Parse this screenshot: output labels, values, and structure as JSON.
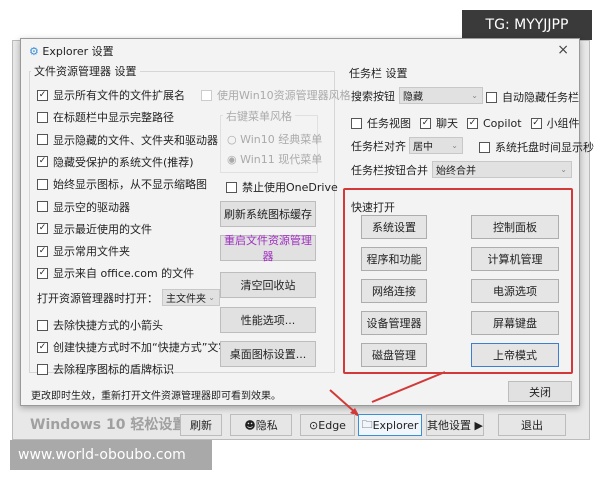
{
  "badge": "TG: MYYJJPP",
  "watermark": "www.world-oboubo.com",
  "dialog": {
    "title": "Explorer 设置",
    "close_icon": "×",
    "explorer_group": {
      "label": "文件资源管理器 设置",
      "options": [
        {
          "label": "显示所有文件的文件扩展名",
          "checked": true
        },
        {
          "label": "在标题栏中显示完整路径",
          "checked": false
        },
        {
          "label": "显示隐藏的文件、文件夹和驱动器",
          "checked": false
        },
        {
          "label": "隐藏受保护的系统文件(推荐)",
          "checked": true
        },
        {
          "label": "始终显示图标，从不显示缩略图",
          "checked": false
        },
        {
          "label": "显示空的驱动器",
          "checked": false
        },
        {
          "label": "显示最近使用的文件",
          "checked": true
        },
        {
          "label": "显示常用文件夹",
          "checked": true
        },
        {
          "label": "显示来自 office.com 的文件",
          "checked": true
        }
      ],
      "open_label": "打开资源管理器时打开：",
      "open_value": "主文件夹",
      "options2": [
        {
          "label": "去除快捷方式的小箭头",
          "checked": false
        },
        {
          "label": "创建快捷方式时不加“快捷方式”文字",
          "checked": true
        },
        {
          "label": "去除程序图标的盾牌标识",
          "checked": false
        }
      ],
      "win10_style": "使用Win10资源管理器风格",
      "menu_style": {
        "label": "右键菜单风格",
        "opt1": "Win10 经典菜单",
        "opt2": "Win11 现代菜单",
        "selected": "Win11 现代菜单"
      },
      "onedrive": "禁止使用OneDrive",
      "buttons": [
        "刷新系统图标缓存",
        "重启文件资源管理器",
        "清空回收站",
        "性能选项...",
        "桌面图标设置..."
      ]
    },
    "taskbar_group": {
      "label": "任务栏 设置",
      "search_label": "搜索按钮",
      "search_value": "隐藏",
      "autohide": "自动隐藏任务栏",
      "task_view": "任务视图",
      "chat": "聊天",
      "copilot": "Copilot",
      "widgets": "小组件",
      "align_label": "任务栏对齐",
      "align_value": "居中",
      "seconds": "系统托盘时间显示秒",
      "combine_label": "任务栏按钮合并",
      "combine_value": "始终合并"
    },
    "quick": {
      "label": "快速打开",
      "buttons": [
        "系统设置",
        "控制面板",
        "程序和功能",
        "计算机管理",
        "网络连接",
        "电源选项",
        "设备管理器",
        "屏幕键盘",
        "磁盘管理",
        "上帝模式"
      ]
    },
    "status": "更改即时生效，重新打开文件资源管理器即可看到效果。",
    "close_button": "关闭"
  },
  "appbar": {
    "title": "Windows 10 轻松设置",
    "buttons": [
      "刷新",
      "隐私",
      "Edge",
      "Explorer",
      "其他设置 ▶",
      "退出"
    ]
  }
}
